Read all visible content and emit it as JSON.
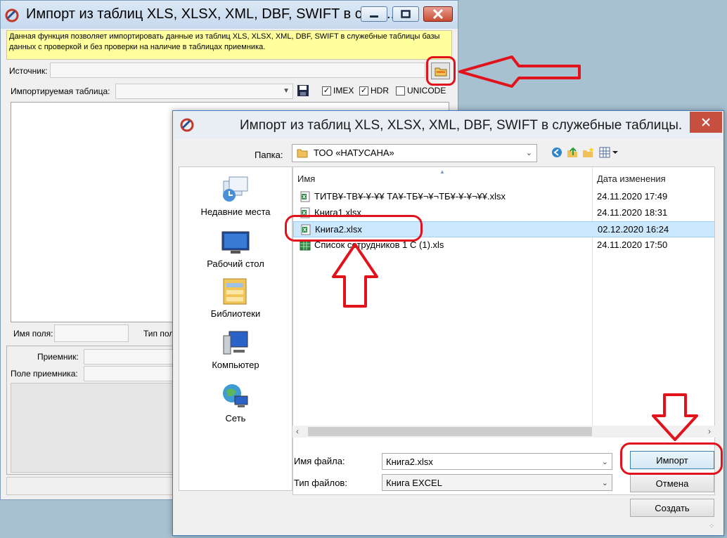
{
  "back_window": {
    "title": "Импорт из таблиц XLS, XLSX, XML, DBF, SWIFT в служ...",
    "info_text": "Данная функция позволяет импортировать данные из таблиц XLS, XLSX, XML, DBF, SWIFT в служебные таблицы базы данных с проверкой и без проверки на наличие в таблицах приемника.",
    "source_label": "Источник:",
    "import_table_label": "Импортируемая таблица:",
    "checkboxes": [
      {
        "label": "IMEX",
        "checked": true
      },
      {
        "label": "HDR",
        "checked": true
      },
      {
        "label": "UNICODE",
        "checked": false
      }
    ],
    "field_name_label": "Имя поля:",
    "field_type_label": "Тип поля",
    "receiver_label": "Приемник:",
    "receiver_field_label": "Поле приемника:"
  },
  "dialog": {
    "title": "Импорт из таблиц XLS, XLSX, XML, DBF, SWIFT в служебные таблицы.",
    "folder_label": "Папка:",
    "folder_value": "ТОО «НАТУСАНА»",
    "places": [
      {
        "label": "Недавние места",
        "icon": "recent-places-icon"
      },
      {
        "label": "Рабочий стол",
        "icon": "desktop-icon"
      },
      {
        "label": "Библиотеки",
        "icon": "libraries-icon"
      },
      {
        "label": "Компьютер",
        "icon": "computer-icon"
      },
      {
        "label": "Сеть",
        "icon": "network-icon"
      }
    ],
    "columns": {
      "name": "Имя",
      "date": "Дата изменения"
    },
    "files": [
      {
        "name": "ТИТВ¥-ТВ¥-¥-¥¥ ТА¥-ТБ¥¬¥¬ТБ¥-¥-¥¬¥¥.xlsx",
        "date": "24.11.2020 17:49",
        "selected": false,
        "icon": "excel-xlsx-icon"
      },
      {
        "name": "Книга1.xlsx",
        "date": "24.11.2020 18:31",
        "selected": false,
        "icon": "excel-xlsx-icon"
      },
      {
        "name": "Книга2.xlsx",
        "date": "02.12.2020 16:24",
        "selected": true,
        "icon": "excel-xlsx-icon"
      },
      {
        "name": "Список сотрудников 1 С (1).xls",
        "date": "24.11.2020 17:50",
        "selected": false,
        "icon": "excel-xls-icon"
      }
    ],
    "filename_label": "Имя файла:",
    "filename_value": "Книга2.xlsx",
    "filetype_label": "Тип файлов:",
    "filetype_value": "Книга EXCEL",
    "buttons": {
      "import": "Импорт",
      "cancel": "Отмена",
      "create": "Создать"
    }
  },
  "colors": {
    "annotation_red": "#e1121b",
    "info_yellow": "#ffff9e",
    "selection_blue": "#cce8ff",
    "dialog_close_red": "#c74f40"
  }
}
